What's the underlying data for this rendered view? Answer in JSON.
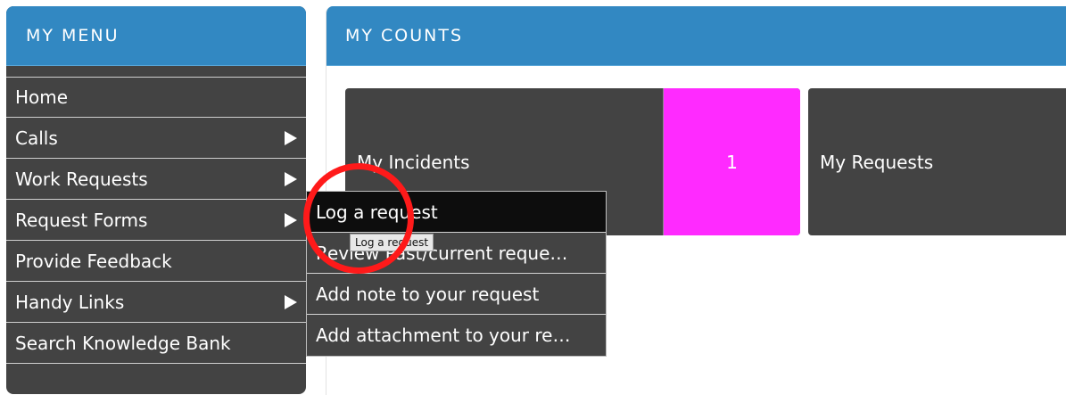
{
  "menu": {
    "title": "MY MENU",
    "items": [
      {
        "label": "Home",
        "has_submenu": false
      },
      {
        "label": "Calls",
        "has_submenu": true
      },
      {
        "label": "Work Requests",
        "has_submenu": true
      },
      {
        "label": "Request Forms",
        "has_submenu": true
      },
      {
        "label": "Provide Feedback",
        "has_submenu": false
      },
      {
        "label": "Handy Links",
        "has_submenu": true
      },
      {
        "label": "Search Knowledge Bank",
        "has_submenu": false
      }
    ]
  },
  "counts": {
    "title": "MY COUNTS",
    "cards": [
      {
        "label": "My Incidents",
        "count": "1"
      },
      {
        "label": "My Requests"
      }
    ]
  },
  "submenu": {
    "items": [
      {
        "label": "Log a request",
        "active": true
      },
      {
        "label": "Review Past/current reque…"
      },
      {
        "label": "Add note to your request"
      },
      {
        "label": "Add attachment to your re…"
      }
    ],
    "tooltip": "Log a request"
  },
  "colors": {
    "header_blue": "#3288c2",
    "menu_bg": "#434343",
    "count_badge": "#ff2aff",
    "highlight_ring": "#ff1a1a"
  }
}
